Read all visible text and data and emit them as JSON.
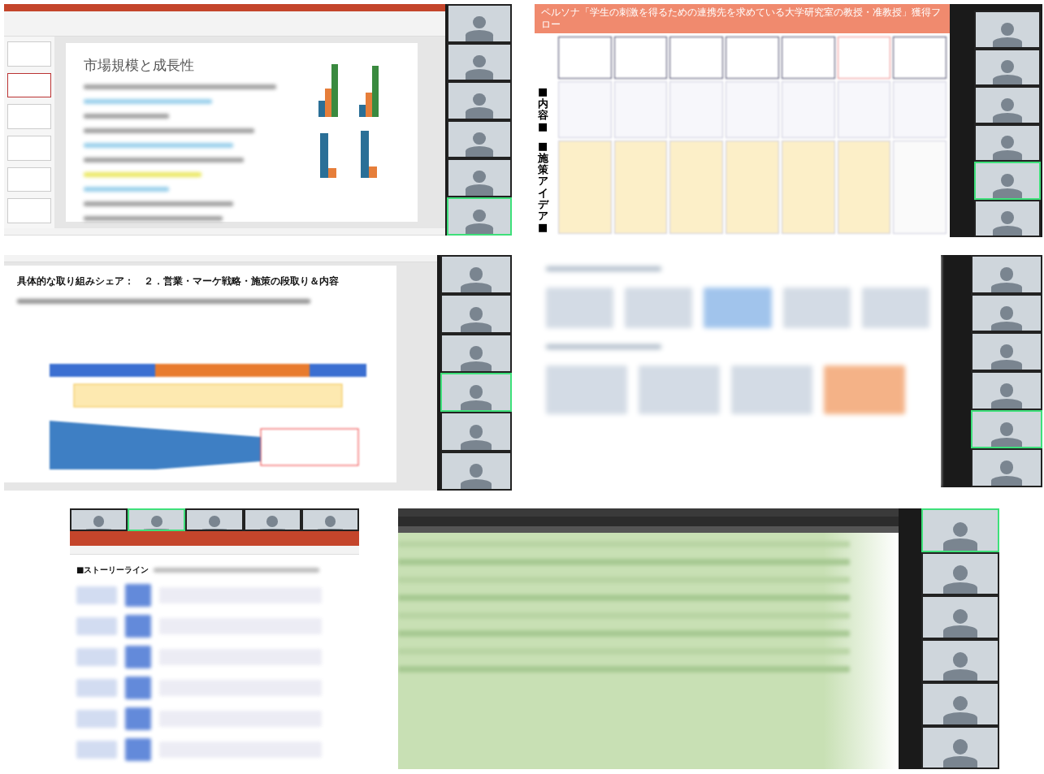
{
  "tiles": [
    {
      "kind": "slides",
      "title": "市場規模と成長性",
      "videos": [
        {
          "highlighted": false
        },
        {
          "highlighted": false
        },
        {
          "highlighted": false
        },
        {
          "highlighted": false
        },
        {
          "highlighted": false
        },
        {
          "highlighted": true
        }
      ]
    },
    {
      "kind": "flow",
      "title": "ペルソナ「学生の刺激を得るための連携先を求めている大学研究室の教授・准教授」獲得フロー",
      "row_labels": [
        "■内容■",
        "■施策アイデア■"
      ],
      "videos": [
        {
          "highlighted": false
        },
        {
          "highlighted": false
        },
        {
          "highlighted": false
        },
        {
          "highlighted": false
        },
        {
          "highlighted": true
        },
        {
          "highlighted": false
        }
      ]
    },
    {
      "kind": "plan",
      "title": "具体的な取り組みシェア：　２．営業・マーケ戦略・施策の段取り＆内容",
      "videos": [
        {
          "highlighted": false
        },
        {
          "highlighted": false
        },
        {
          "highlighted": false
        },
        {
          "highlighted": true
        },
        {
          "highlighted": false
        },
        {
          "highlighted": false
        }
      ]
    },
    {
      "kind": "blurred",
      "videos": [
        {
          "highlighted": false
        },
        {
          "highlighted": false
        },
        {
          "highlighted": false
        },
        {
          "highlighted": false
        },
        {
          "highlighted": true
        },
        {
          "highlighted": false
        }
      ]
    },
    {
      "kind": "storyline",
      "title": "■ストーリーライン",
      "videos": [
        {
          "highlighted": false
        },
        {
          "highlighted": true
        },
        {
          "highlighted": false
        },
        {
          "highlighted": false
        },
        {
          "highlighted": false
        }
      ]
    },
    {
      "kind": "sheet",
      "videos": [
        {
          "highlighted": true
        },
        {
          "highlighted": false
        },
        {
          "highlighted": false
        },
        {
          "highlighted": false
        },
        {
          "highlighted": false
        },
        {
          "highlighted": false
        }
      ]
    }
  ]
}
